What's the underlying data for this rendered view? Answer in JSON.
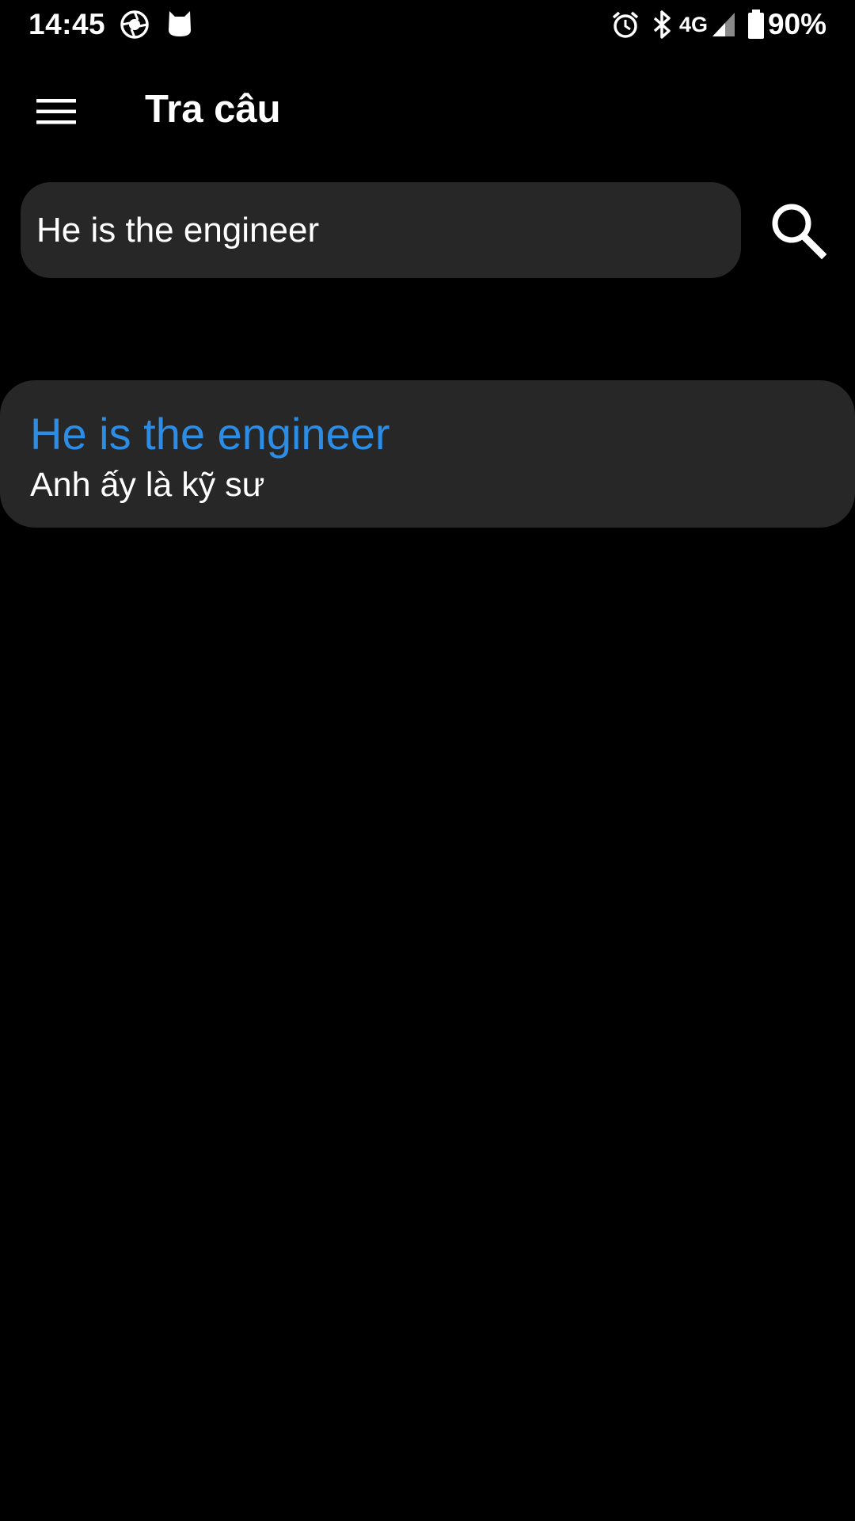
{
  "status_bar": {
    "time": "14:45",
    "network": "4G",
    "battery_percent": "90%",
    "icons": [
      "aperture-icon",
      "cat-icon",
      "alarm-icon",
      "bluetooth-icon",
      "signal-icon",
      "battery-icon"
    ]
  },
  "app_bar": {
    "title": "Tra câu",
    "menu_icon": "menu-icon"
  },
  "search": {
    "value": "He is the engineer",
    "placeholder": "",
    "button_icon": "search-icon"
  },
  "results": [
    {
      "source": "He is the engineer",
      "translation": "Anh ấy là kỹ sư"
    }
  ],
  "colors": {
    "background": "#000000",
    "surface": "#272727",
    "accent": "#2b8de5",
    "text": "#ffffff"
  }
}
